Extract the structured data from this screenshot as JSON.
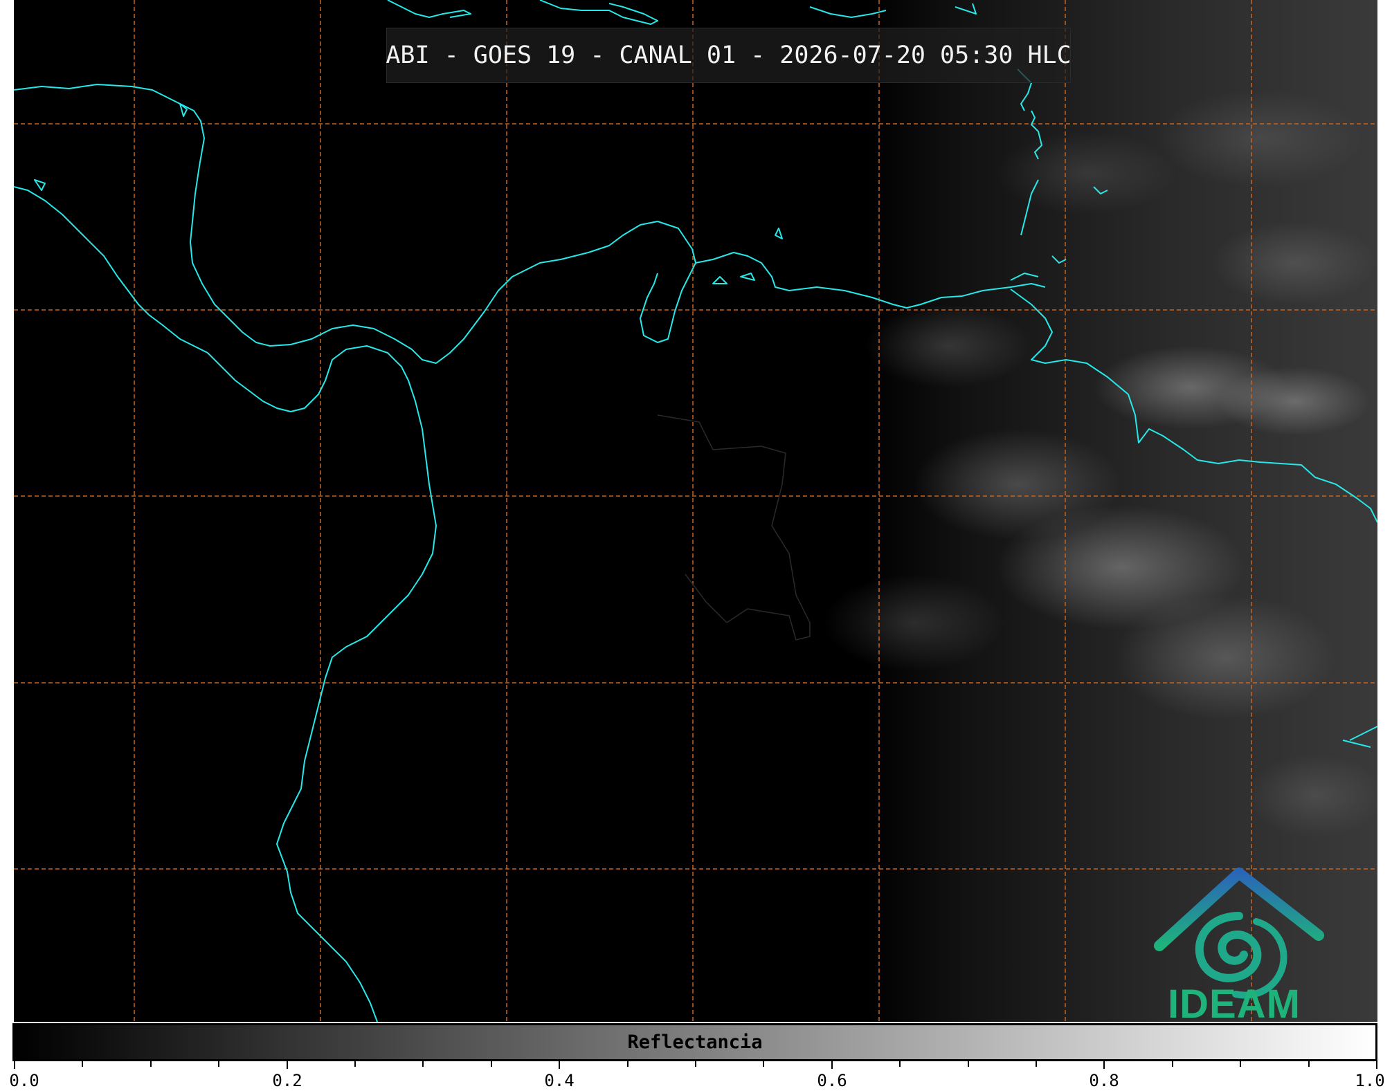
{
  "title": "ABI - GOES 19 - CANAL 01 - 2026-07-20 05:30 HLC",
  "logo": {
    "name": "ideam-logo",
    "text": "IDEAM"
  },
  "colorbar": {
    "label": "Reflectancia",
    "min": 0.0,
    "max": 1.0,
    "tick_labels": [
      "0.0",
      "0.2",
      "0.4",
      "0.6",
      "0.8",
      "1.0"
    ],
    "colormap": [
      "#000000",
      "#ffffff"
    ]
  },
  "colors": {
    "coastline": "#27e8e8",
    "graticule": "#c8641e",
    "borders": "#2a2a2a"
  }
}
